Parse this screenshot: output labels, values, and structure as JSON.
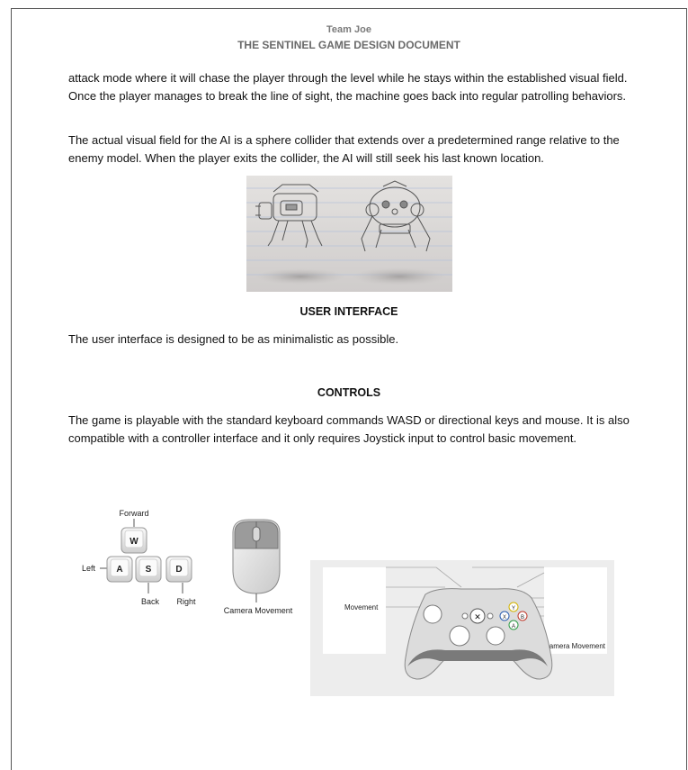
{
  "header": {
    "team": "Team Joe",
    "title": "THE SENTINEL GAME DESIGN DOCUMENT"
  },
  "paragraphs": {
    "p1": "attack mode where it will chase the player through the level while he stays within the established visual field. Once the player manages to break the line of sight, the machine goes back into regular patrolling behaviors.",
    "p2": "The actual visual field for the AI is a sphere collider that extends over a predetermined range relative to the enemy model. When the player exits the collider, the AI will still seek his last known location.",
    "p3": "The user interface is designed to be as minimalistic as possible.",
    "p4": "The game is playable with the standard keyboard commands WASD or directional keys and mouse. It is also compatible with a controller interface and it only requires Joystick input to control basic movement."
  },
  "headings": {
    "ui": "USER INTERFACE",
    "controls": "CONTROLS"
  },
  "keyboard": {
    "forward": "Forward",
    "left": "Left",
    "back": "Back",
    "right": "Right",
    "keys": [
      "W",
      "A",
      "S",
      "D"
    ],
    "mouse_label": "Camera Movement"
  },
  "controller": {
    "movement": "Movement",
    "camera": "Camera Movement",
    "buttons": [
      "Y",
      "X",
      "B",
      "A"
    ]
  }
}
